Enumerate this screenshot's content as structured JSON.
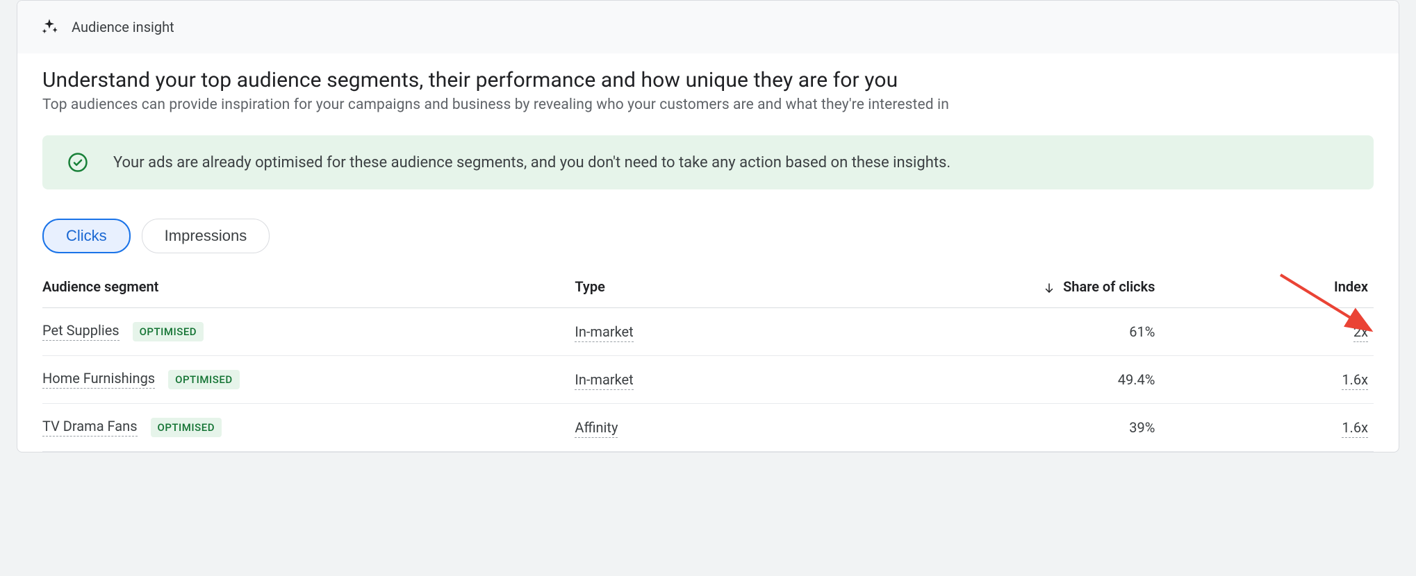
{
  "header": {
    "label": "Audience insight"
  },
  "main": {
    "title": "Understand your top audience segments, their performance and how unique they are for you",
    "subtitle": "Top audiences can provide inspiration for your campaigns and business by revealing who your customers are and what they're interested in"
  },
  "notice": {
    "text": "Your ads are already optimised for these audience segments, and you don't need to take any action based on these insights."
  },
  "tabs": {
    "active": "Clicks",
    "inactive": "Impressions"
  },
  "columns": {
    "segment": "Audience segment",
    "type": "Type",
    "share": "Share of clicks",
    "index": "Index"
  },
  "badge_label": "OPTIMISED",
  "rows": [
    {
      "segment": "Pet Supplies",
      "type": "In-market",
      "share": "61%",
      "index": "2x"
    },
    {
      "segment": "Home Furnishings",
      "type": "In-market",
      "share": "49.4%",
      "index": "1.6x"
    },
    {
      "segment": "TV Drama Fans",
      "type": "Affinity",
      "share": "39%",
      "index": "1.6x"
    }
  ]
}
